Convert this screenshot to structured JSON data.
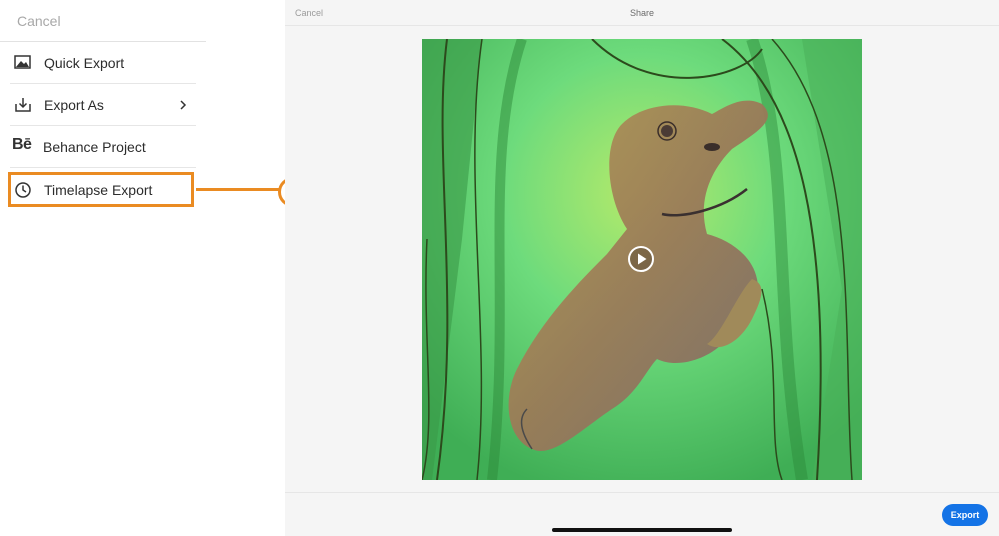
{
  "left_panel": {
    "cancel_label": "Cancel",
    "menu_items": [
      {
        "label": "Quick Export",
        "icon": "image-icon"
      },
      {
        "label": "Export As",
        "icon": "download-icon",
        "has_submenu": true
      },
      {
        "label": "Behance Project",
        "icon": "behance-icon"
      },
      {
        "label": "Timelapse Export",
        "icon": "clock-icon",
        "highlighted": true
      }
    ]
  },
  "share_panel": {
    "cancel_label": "Cancel",
    "title": "Share",
    "export_label": "Export"
  },
  "colors": {
    "highlight": "#ea8b22",
    "accent": "#1473e6",
    "artwork_bg": "#5fd47e"
  }
}
